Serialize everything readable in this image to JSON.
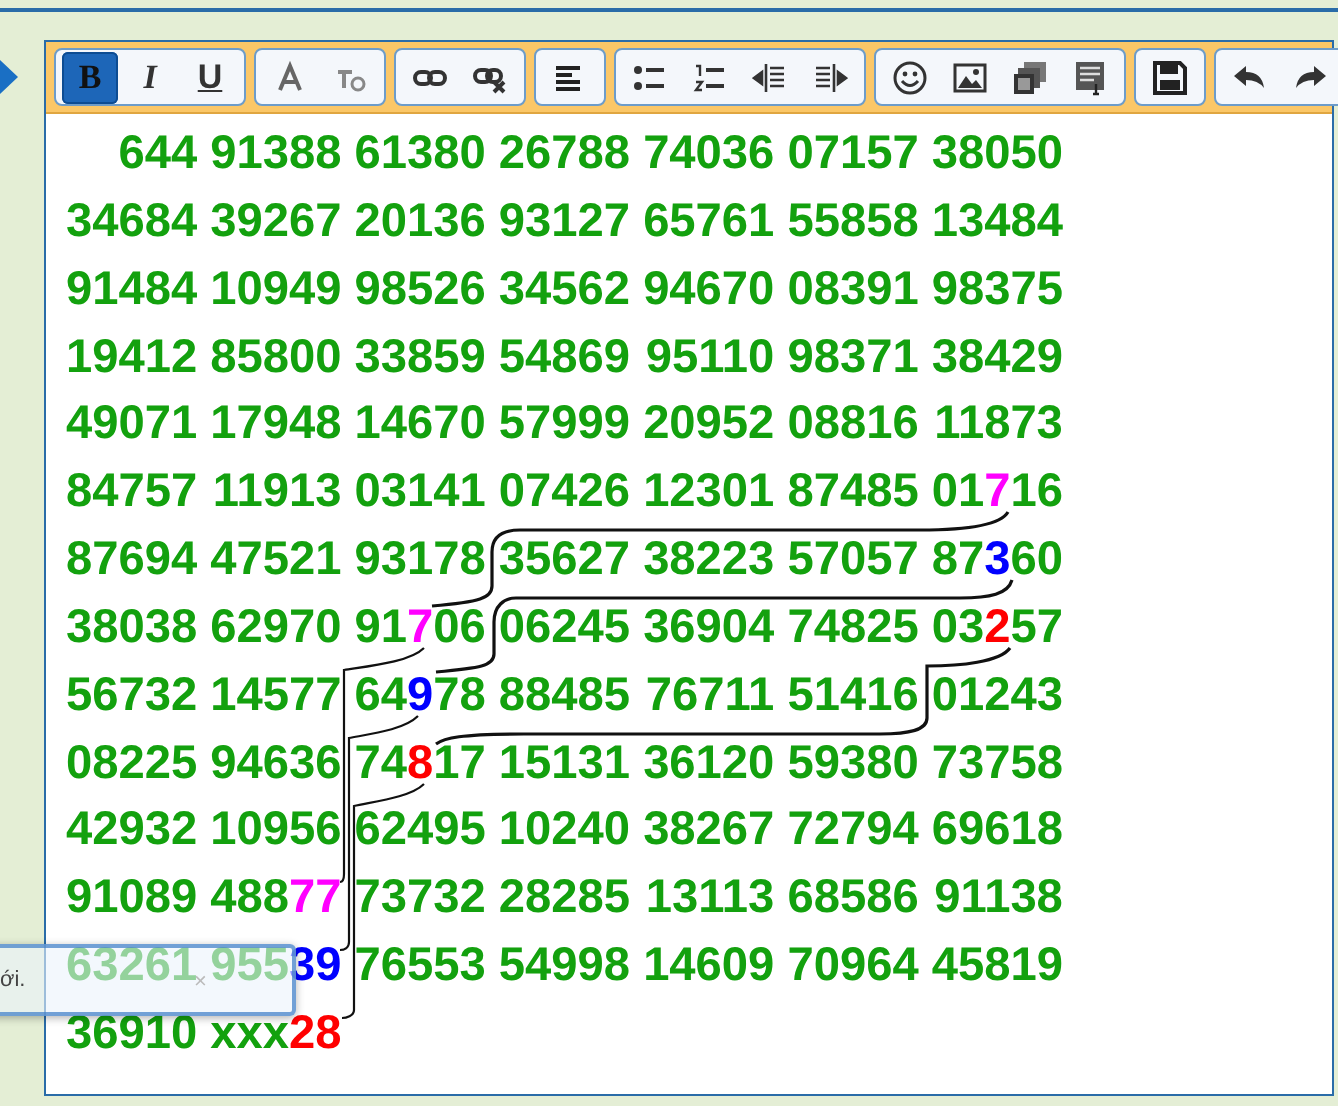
{
  "toolbar": {
    "groups": [
      {
        "buttons": [
          {
            "kind": "bold",
            "label": "B",
            "selected": true
          },
          {
            "kind": "italic",
            "label": "I",
            "selected": false
          },
          {
            "kind": "underline",
            "label": "U",
            "selected": false
          }
        ]
      },
      {
        "buttons": [
          {
            "kind": "font-color"
          },
          {
            "kind": "clear-format"
          }
        ]
      },
      {
        "buttons": [
          {
            "kind": "link"
          },
          {
            "kind": "unlink"
          }
        ]
      },
      {
        "buttons": [
          {
            "kind": "align-left"
          }
        ]
      },
      {
        "buttons": [
          {
            "kind": "bullet-list"
          },
          {
            "kind": "number-list"
          },
          {
            "kind": "outdent"
          },
          {
            "kind": "indent"
          }
        ]
      },
      {
        "buttons": [
          {
            "kind": "smiley"
          },
          {
            "kind": "image"
          },
          {
            "kind": "media"
          },
          {
            "kind": "template"
          }
        ]
      },
      {
        "buttons": [
          {
            "kind": "save"
          }
        ]
      },
      {
        "buttons": [
          {
            "kind": "undo"
          },
          {
            "kind": "redo"
          }
        ]
      }
    ]
  },
  "sheet": {
    "rows": [
      [
        "644",
        "91388",
        "61380",
        "26788",
        "74036",
        "07157",
        "38050"
      ],
      [
        "34684",
        "39267",
        "20136",
        "93127",
        "65761",
        "55858",
        "13484"
      ],
      [
        "91484",
        "10949",
        "98526",
        "34562",
        "94670",
        "08391",
        "98375"
      ],
      [
        "19412",
        "85800",
        "33859",
        "54869",
        "95110",
        "98371",
        "38429"
      ],
      [
        "49071",
        "17948",
        "14670",
        "57999",
        "20952",
        "08816",
        "11873"
      ],
      [
        "84757",
        "11913",
        "03141",
        "07426",
        "12301",
        "87485",
        {
          "parts": [
            {
              "text": "01"
            },
            {
              "text": "7",
              "color": "#ff00ff"
            },
            {
              "text": "16"
            }
          ]
        }
      ],
      [
        "87694",
        "47521",
        "93178",
        "35627",
        "38223",
        "57057",
        {
          "parts": [
            {
              "text": "87"
            },
            {
              "text": "3",
              "color": "#0000ff"
            },
            {
              "text": "60"
            }
          ]
        }
      ],
      [
        "38038",
        "62970",
        {
          "parts": [
            {
              "text": "91"
            },
            {
              "text": "7",
              "color": "#ff00ff"
            },
            {
              "text": "06"
            }
          ]
        },
        "06245",
        "36904",
        "74825",
        {
          "parts": [
            {
              "text": "03"
            },
            {
              "text": "2",
              "color": "#ff0000"
            },
            {
              "text": "57"
            }
          ]
        }
      ],
      [
        "56732",
        "14577",
        {
          "parts": [
            {
              "text": "64"
            },
            {
              "text": "9",
              "color": "#0000ff"
            },
            {
              "text": "78"
            }
          ]
        },
        "88485",
        "76711",
        "51416",
        "01243"
      ],
      [
        "08225",
        "94636",
        {
          "parts": [
            {
              "text": "74"
            },
            {
              "text": "8",
              "color": "#ff0000"
            },
            {
              "text": "17"
            }
          ]
        },
        "15131",
        "36120",
        "59380",
        "73758"
      ],
      [
        "42932",
        "10956",
        "62495",
        "10240",
        "38267",
        "72794",
        "69618"
      ],
      [
        "91089",
        {
          "parts": [
            {
              "text": "488"
            },
            {
              "text": "77",
              "color": "#ff00ff"
            }
          ]
        },
        "73732",
        "28285",
        "13113",
        "68586",
        "91138"
      ],
      [
        "63261",
        {
          "parts": [
            {
              "text": "955"
            },
            {
              "text": "39",
              "color": "#0000ff"
            }
          ]
        },
        "76553",
        "54998",
        "14609",
        "70964",
        "45819"
      ],
      [
        "36910",
        {
          "parts": [
            {
              "text": "xxx"
            },
            {
              "text": "28",
              "color": "#ff0000"
            }
          ]
        }
      ]
    ]
  },
  "toast": {
    "text": "ới.",
    "close": "×"
  }
}
